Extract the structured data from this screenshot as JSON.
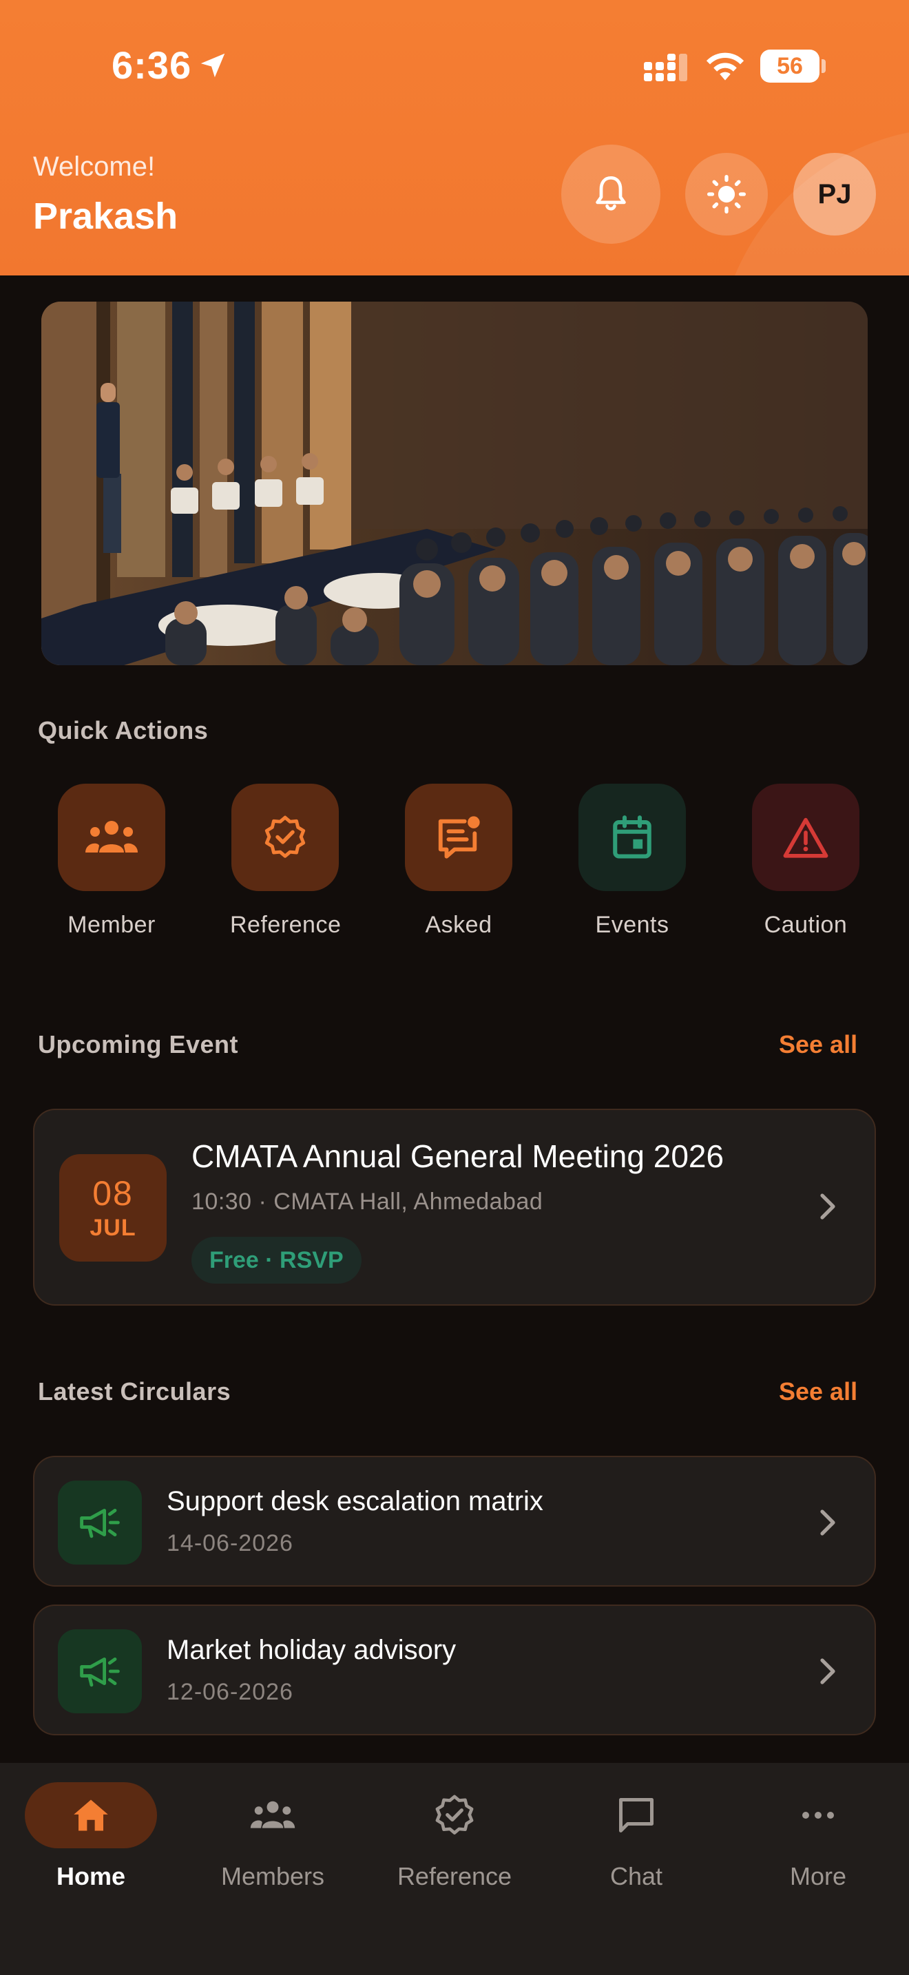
{
  "status_bar": {
    "time": "6:36",
    "battery": "56"
  },
  "header": {
    "welcome": "Welcome!",
    "user_name": "Prakash",
    "avatar_initials": "PJ"
  },
  "quick_actions": {
    "title": "Quick Actions",
    "items": [
      {
        "label": "Member",
        "icon": "member-group-icon",
        "tone": "#f47e33"
      },
      {
        "label": "Reference",
        "icon": "verified-badge-icon",
        "tone": "#f47e33"
      },
      {
        "label": "Asked",
        "icon": "message-notice-icon",
        "tone": "#f47e33"
      },
      {
        "label": "Events",
        "icon": "calendar-icon",
        "tone": "#2f9e78"
      },
      {
        "label": "Caution",
        "icon": "warning-icon",
        "tone": "#d63a36"
      }
    ]
  },
  "upcoming_event": {
    "title": "Upcoming Event",
    "see_all": "See all",
    "event": {
      "day": "08",
      "month": "JUL",
      "name": "CMATA Annual General Meeting 2026",
      "meta": "10:30 · CMATA Hall, Ahmedabad",
      "badge": "Free · RSVP"
    }
  },
  "circulars": {
    "title": "Latest Circulars",
    "see_all": "See all",
    "items": [
      {
        "title": "Support desk escalation matrix",
        "date": "14-06-2026"
      },
      {
        "title": "Market holiday advisory",
        "date": "12-06-2026"
      }
    ]
  },
  "bottom_nav": {
    "items": [
      {
        "label": "Home",
        "icon": "home-icon",
        "active": true
      },
      {
        "label": "Members",
        "icon": "members-icon",
        "active": false
      },
      {
        "label": "Reference",
        "icon": "reference-badge-icon",
        "active": false
      },
      {
        "label": "Chat",
        "icon": "chat-icon",
        "active": false
      },
      {
        "label": "More",
        "icon": "more-dots-icon",
        "active": false
      }
    ]
  },
  "colors": {
    "accent": "#f47e33",
    "background": "#120d0b",
    "card": "#211d1b",
    "success": "#2f9e78",
    "danger": "#d63a36"
  }
}
